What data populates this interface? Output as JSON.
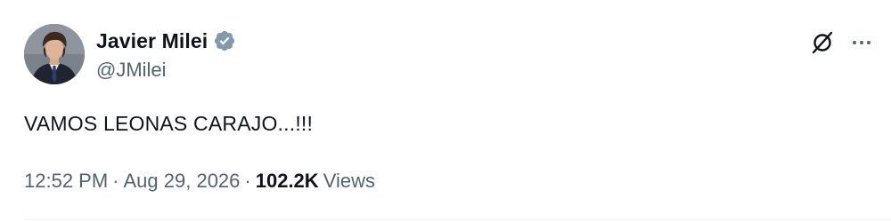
{
  "tweet": {
    "author": {
      "display_name": "Javier Milei",
      "handle": "@JMilei",
      "verified": true
    },
    "text": "VAMOS LEONAS CARAJO...!!!",
    "meta": {
      "time": "12:52 PM",
      "separator": "·",
      "date": "Aug 29, 2026",
      "views_count": "102.2K",
      "views_label": "Views"
    },
    "actions": {
      "grok_icon": "grok-icon",
      "more_icon": "more-horizontal-icon"
    }
  },
  "colors": {
    "text_primary": "#0f1419",
    "text_secondary": "#536471",
    "verified_badge": "#829aab",
    "divider": "#eff3f4"
  }
}
